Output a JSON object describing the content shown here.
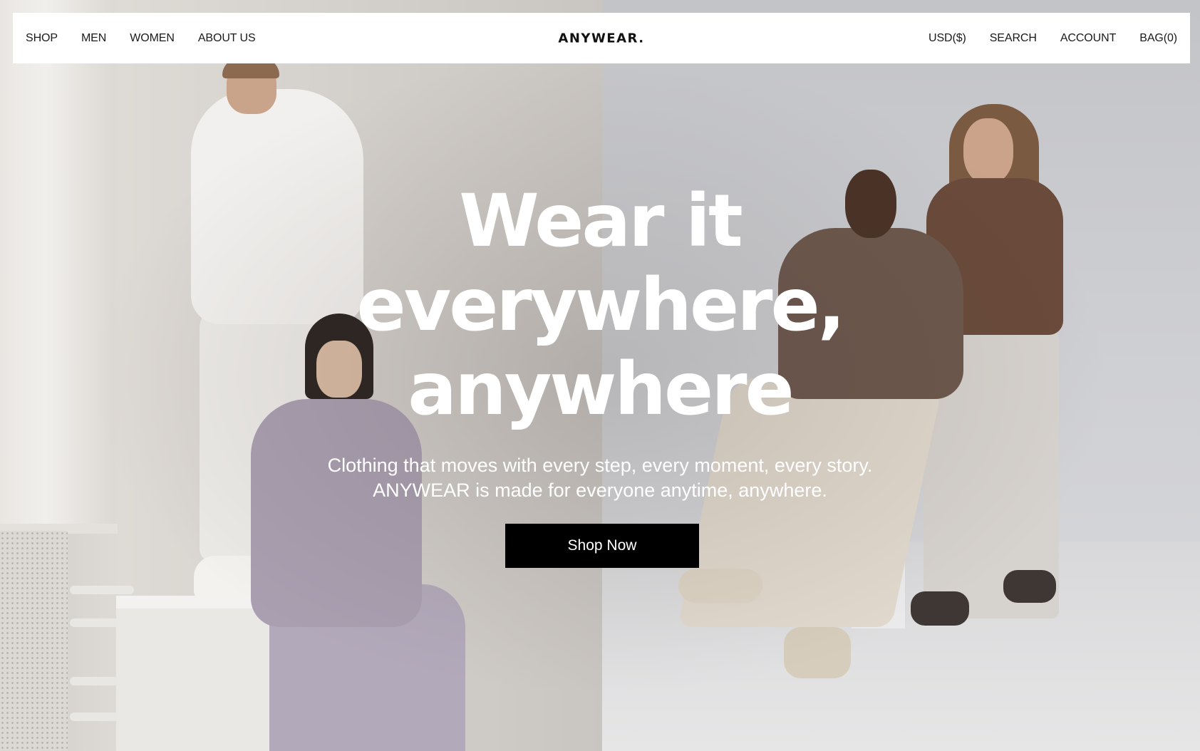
{
  "nav": {
    "left_links": [
      "SHOP",
      "MEN",
      "WOMEN",
      "ABOUT US"
    ],
    "brand": "ANYWEAR.",
    "right_links": [
      "USD($)",
      "SEARCH",
      "ACCOUNT",
      "BAG(0)"
    ]
  },
  "hero": {
    "headline_lines": [
      "Wear it",
      "everywhere,",
      "anywhere"
    ],
    "subcopy_lines": [
      "Clothing that moves with every step, every moment, every story.",
      "ANYWEAR is made for everyone anytime, anywhere."
    ],
    "cta_label": "Shop Now",
    "image": {
      "scene": "models-lifestyle-photo"
    }
  },
  "colors": {
    "nav_background": "#ffffff",
    "text_dark": "#1a1a1a",
    "hero_text": "#ffffff",
    "cta_background": "#000000",
    "cta_text": "#ffffff"
  }
}
